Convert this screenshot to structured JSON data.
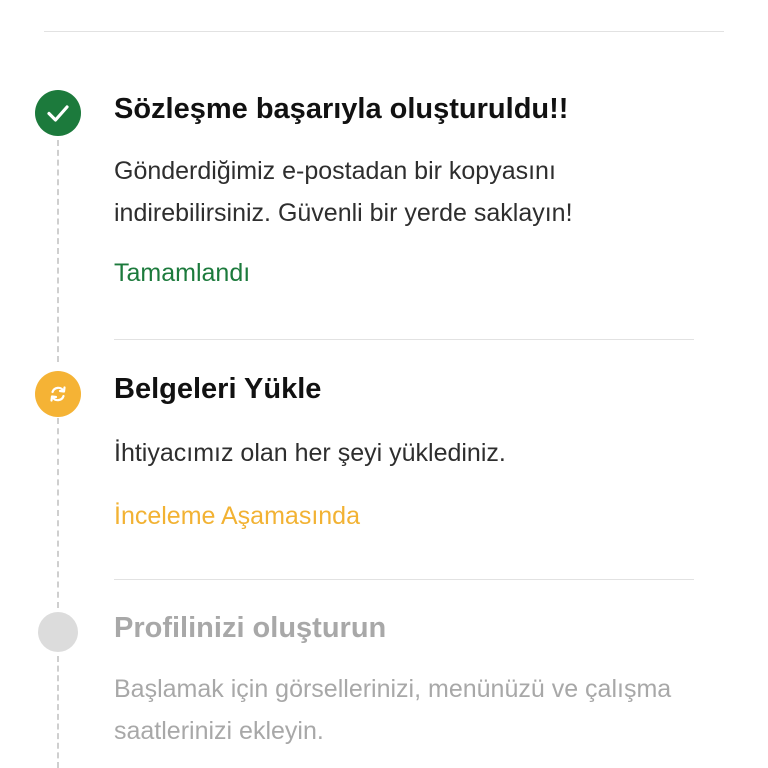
{
  "steps": [
    {
      "title": "Sözleşme başarıyla oluşturuldu!!",
      "description": "Gönderdiğimiz e-postadan bir kopyasını indirebilirsiniz. Güvenli bir yerde saklayın!",
      "status": "Tamamlandı",
      "icon": "check-icon",
      "state": "completed"
    },
    {
      "title": "Belgeleri Yükle",
      "description": "İhtiyacımız olan her şeyi yüklediniz.",
      "status": "İnceleme Aşamasında",
      "icon": "refresh-icon",
      "state": "in-review"
    },
    {
      "title": "Profilinizi oluşturun",
      "description": "Başlamak için görsellerinizi, menünüzü ve çalışma saatlerinizi ekleyin.",
      "icon": "empty-circle-icon",
      "state": "inactive"
    }
  ],
  "colors": {
    "completed": "#1c7a3c",
    "in_review": "#f5b335",
    "inactive": "#dcdcdc",
    "muted_text": "#a8a8a8"
  }
}
